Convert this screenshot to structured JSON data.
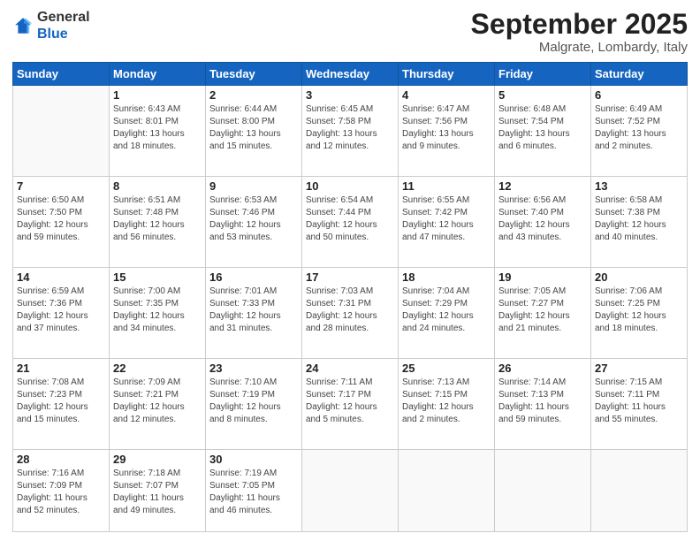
{
  "logo": {
    "general": "General",
    "blue": "Blue"
  },
  "header": {
    "month": "September 2025",
    "location": "Malgrate, Lombardy, Italy"
  },
  "weekdays": [
    "Sunday",
    "Monday",
    "Tuesday",
    "Wednesday",
    "Thursday",
    "Friday",
    "Saturday"
  ],
  "weeks": [
    [
      {
        "day": "",
        "info": ""
      },
      {
        "day": "1",
        "info": "Sunrise: 6:43 AM\nSunset: 8:01 PM\nDaylight: 13 hours\nand 18 minutes."
      },
      {
        "day": "2",
        "info": "Sunrise: 6:44 AM\nSunset: 8:00 PM\nDaylight: 13 hours\nand 15 minutes."
      },
      {
        "day": "3",
        "info": "Sunrise: 6:45 AM\nSunset: 7:58 PM\nDaylight: 13 hours\nand 12 minutes."
      },
      {
        "day": "4",
        "info": "Sunrise: 6:47 AM\nSunset: 7:56 PM\nDaylight: 13 hours\nand 9 minutes."
      },
      {
        "day": "5",
        "info": "Sunrise: 6:48 AM\nSunset: 7:54 PM\nDaylight: 13 hours\nand 6 minutes."
      },
      {
        "day": "6",
        "info": "Sunrise: 6:49 AM\nSunset: 7:52 PM\nDaylight: 13 hours\nand 2 minutes."
      }
    ],
    [
      {
        "day": "7",
        "info": "Sunrise: 6:50 AM\nSunset: 7:50 PM\nDaylight: 12 hours\nand 59 minutes."
      },
      {
        "day": "8",
        "info": "Sunrise: 6:51 AM\nSunset: 7:48 PM\nDaylight: 12 hours\nand 56 minutes."
      },
      {
        "day": "9",
        "info": "Sunrise: 6:53 AM\nSunset: 7:46 PM\nDaylight: 12 hours\nand 53 minutes."
      },
      {
        "day": "10",
        "info": "Sunrise: 6:54 AM\nSunset: 7:44 PM\nDaylight: 12 hours\nand 50 minutes."
      },
      {
        "day": "11",
        "info": "Sunrise: 6:55 AM\nSunset: 7:42 PM\nDaylight: 12 hours\nand 47 minutes."
      },
      {
        "day": "12",
        "info": "Sunrise: 6:56 AM\nSunset: 7:40 PM\nDaylight: 12 hours\nand 43 minutes."
      },
      {
        "day": "13",
        "info": "Sunrise: 6:58 AM\nSunset: 7:38 PM\nDaylight: 12 hours\nand 40 minutes."
      }
    ],
    [
      {
        "day": "14",
        "info": "Sunrise: 6:59 AM\nSunset: 7:36 PM\nDaylight: 12 hours\nand 37 minutes."
      },
      {
        "day": "15",
        "info": "Sunrise: 7:00 AM\nSunset: 7:35 PM\nDaylight: 12 hours\nand 34 minutes."
      },
      {
        "day": "16",
        "info": "Sunrise: 7:01 AM\nSunset: 7:33 PM\nDaylight: 12 hours\nand 31 minutes."
      },
      {
        "day": "17",
        "info": "Sunrise: 7:03 AM\nSunset: 7:31 PM\nDaylight: 12 hours\nand 28 minutes."
      },
      {
        "day": "18",
        "info": "Sunrise: 7:04 AM\nSunset: 7:29 PM\nDaylight: 12 hours\nand 24 minutes."
      },
      {
        "day": "19",
        "info": "Sunrise: 7:05 AM\nSunset: 7:27 PM\nDaylight: 12 hours\nand 21 minutes."
      },
      {
        "day": "20",
        "info": "Sunrise: 7:06 AM\nSunset: 7:25 PM\nDaylight: 12 hours\nand 18 minutes."
      }
    ],
    [
      {
        "day": "21",
        "info": "Sunrise: 7:08 AM\nSunset: 7:23 PM\nDaylight: 12 hours\nand 15 minutes."
      },
      {
        "day": "22",
        "info": "Sunrise: 7:09 AM\nSunset: 7:21 PM\nDaylight: 12 hours\nand 12 minutes."
      },
      {
        "day": "23",
        "info": "Sunrise: 7:10 AM\nSunset: 7:19 PM\nDaylight: 12 hours\nand 8 minutes."
      },
      {
        "day": "24",
        "info": "Sunrise: 7:11 AM\nSunset: 7:17 PM\nDaylight: 12 hours\nand 5 minutes."
      },
      {
        "day": "25",
        "info": "Sunrise: 7:13 AM\nSunset: 7:15 PM\nDaylight: 12 hours\nand 2 minutes."
      },
      {
        "day": "26",
        "info": "Sunrise: 7:14 AM\nSunset: 7:13 PM\nDaylight: 11 hours\nand 59 minutes."
      },
      {
        "day": "27",
        "info": "Sunrise: 7:15 AM\nSunset: 7:11 PM\nDaylight: 11 hours\nand 55 minutes."
      }
    ],
    [
      {
        "day": "28",
        "info": "Sunrise: 7:16 AM\nSunset: 7:09 PM\nDaylight: 11 hours\nand 52 minutes."
      },
      {
        "day": "29",
        "info": "Sunrise: 7:18 AM\nSunset: 7:07 PM\nDaylight: 11 hours\nand 49 minutes."
      },
      {
        "day": "30",
        "info": "Sunrise: 7:19 AM\nSunset: 7:05 PM\nDaylight: 11 hours\nand 46 minutes."
      },
      {
        "day": "",
        "info": ""
      },
      {
        "day": "",
        "info": ""
      },
      {
        "day": "",
        "info": ""
      },
      {
        "day": "",
        "info": ""
      }
    ]
  ]
}
